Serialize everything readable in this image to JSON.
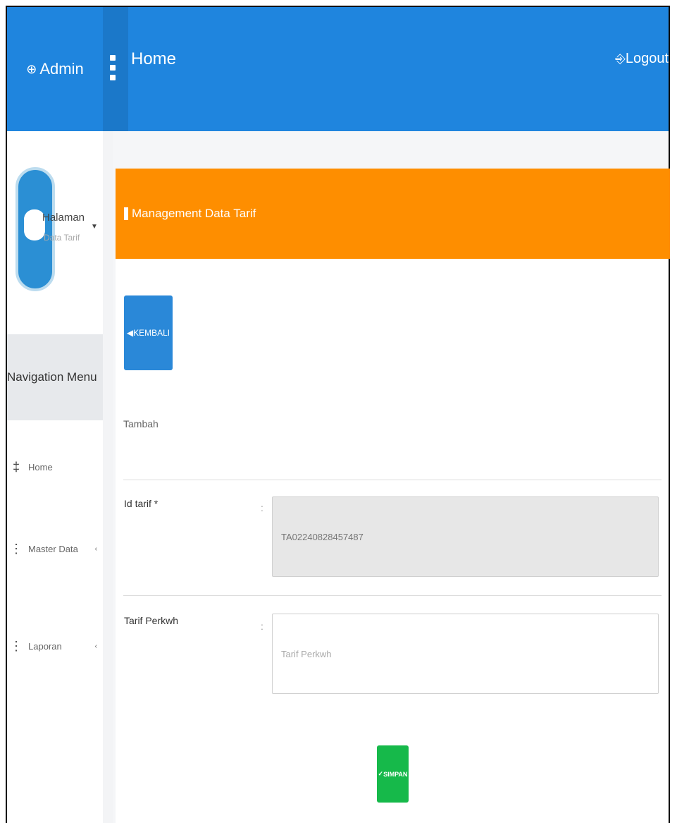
{
  "header": {
    "brand_icon": "user-circle-icon",
    "brand_label": "Admin",
    "title": "Home",
    "logout_label": "Logout",
    "accent_color": "#1f85de"
  },
  "user_panel": {
    "name": "Halaman",
    "role": "Data Tarif"
  },
  "sidebar": {
    "header": "Navigation Menu",
    "items": [
      {
        "label": "Home",
        "icon": "home-icon"
      },
      {
        "label": "Master Data",
        "icon": "list-icon",
        "has_children": true
      },
      {
        "label": "Laporan",
        "icon": "report-icon",
        "has_children": true
      }
    ]
  },
  "panel": {
    "title": "Management Data Tarif",
    "header_color": "#fe8e00",
    "back_button": "KEMBALI",
    "section_label": "Tambah",
    "fields": [
      {
        "label": "Id tarif *",
        "value": "TA02240828457487",
        "readonly": true
      },
      {
        "label": "Tarif Perkwh",
        "value": "",
        "placeholder": "Tarif Perkwh",
        "readonly": false
      }
    ],
    "save_button": "SIMPAN",
    "save_color": "#16b94a"
  }
}
